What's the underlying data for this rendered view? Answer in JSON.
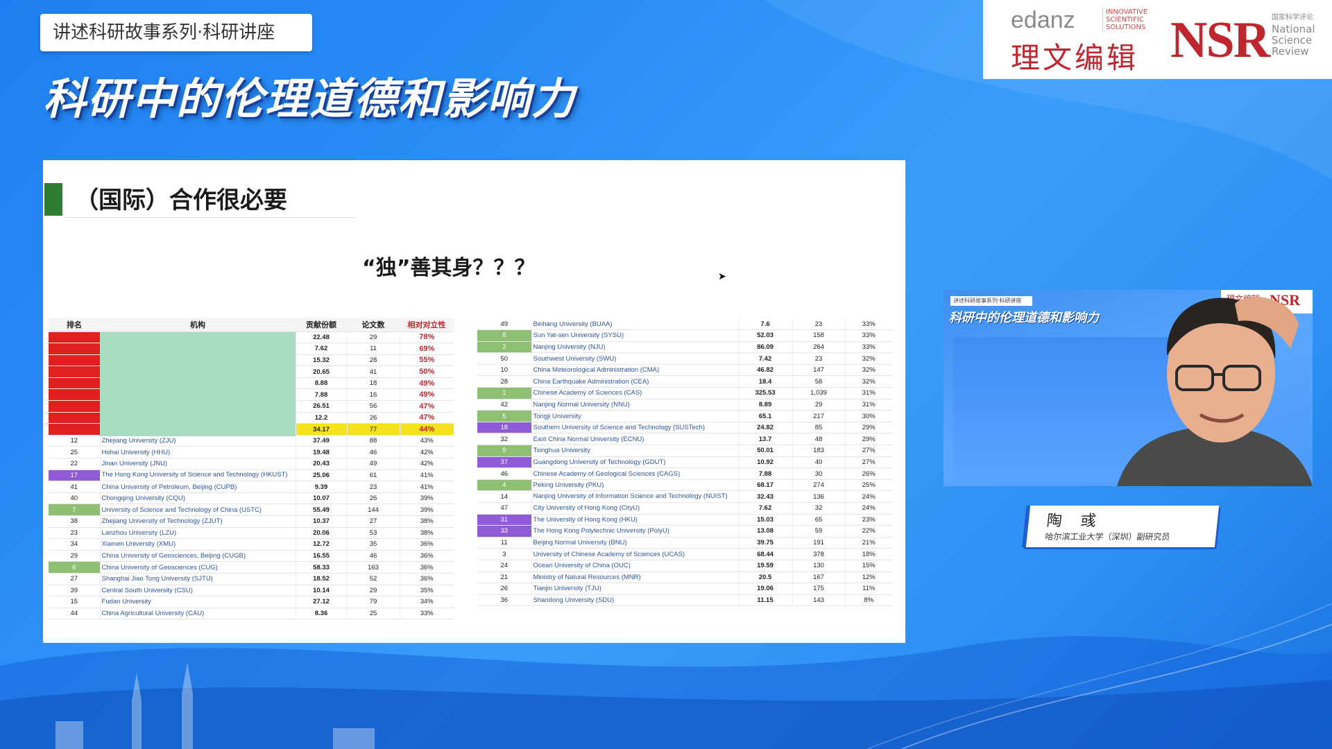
{
  "header": {
    "series_label": "讲述科研故事系列·科研讲座",
    "main_title": "科研中的伦理道德和影响力"
  },
  "logos": {
    "edanz_word": "edanz",
    "edanz_tag": "INNOVATIVE SCIENTIFIC SOLUTIONS",
    "edanz_cn": "理文编辑",
    "nsr_word": "NSR",
    "nsr_cn": "国家科学评论",
    "nsr_side": [
      "National",
      "Science",
      "Review"
    ]
  },
  "colors": {
    "brand_red": "#c0262d",
    "bg_blue": "#2a8ef6",
    "heading_green": "#2e7d32",
    "rank_red": "#e0201f",
    "rank_green": "#8fbf72",
    "rank_purple": "#8f5bd6",
    "highlight_yellow": "#f6e11d"
  },
  "slide": {
    "heading": "（国际）合作很必要",
    "subheading": "“独”善其身？？？",
    "table_left": {
      "headers": [
        "排名",
        "机构",
        "贡献份额",
        "论文数",
        "相对对立性"
      ],
      "rows": [
        {
          "rank": "",
          "name": "",
          "share": "22.48",
          "papers": "29",
          "pct": "78%",
          "rank_style": "red",
          "pct_style": "red"
        },
        {
          "rank": "",
          "name": "",
          "share": "7.62",
          "papers": "11",
          "pct": "69%",
          "rank_style": "red",
          "pct_style": "red"
        },
        {
          "rank": "",
          "name": "",
          "share": "15.32",
          "papers": "28",
          "pct": "55%",
          "rank_style": "red",
          "pct_style": "red"
        },
        {
          "rank": "",
          "name": "",
          "share": "20.65",
          "papers": "41",
          "pct": "50%",
          "rank_style": "red",
          "pct_style": "red"
        },
        {
          "rank": "",
          "name": "",
          "share": "8.88",
          "papers": "18",
          "pct": "49%",
          "rank_style": "red",
          "pct_style": "red"
        },
        {
          "rank": "",
          "name": "",
          "share": "7.88",
          "papers": "16",
          "pct": "49%",
          "rank_style": "red",
          "pct_style": "red"
        },
        {
          "rank": "",
          "name": "",
          "share": "26.51",
          "papers": "56",
          "pct": "47%",
          "rank_style": "red",
          "pct_style": "red"
        },
        {
          "rank": "",
          "name": "",
          "share": "12.2",
          "papers": "26",
          "pct": "47%",
          "rank_style": "red",
          "pct_style": "red"
        },
        {
          "rank": "",
          "name": "",
          "share": "34.17",
          "papers": "77",
          "pct": "44%",
          "rank_style": "red",
          "pct_style": "red",
          "row_style": "yellow"
        },
        {
          "rank": "12",
          "name": "Zhejiang University (ZJU)",
          "share": "37.49",
          "papers": "88",
          "pct": "43%"
        },
        {
          "rank": "25",
          "name": "Hohai University (HHU)",
          "share": "19.48",
          "papers": "46",
          "pct": "42%"
        },
        {
          "rank": "22",
          "name": "Jinan University (JNU)",
          "share": "20.43",
          "papers": "49",
          "pct": "42%"
        },
        {
          "rank": "17",
          "name": "The Hong Kong University of Science and Technology (HKUST)",
          "share": "25.06",
          "papers": "61",
          "pct": "41%",
          "rank_style": "purple",
          "tall": true
        },
        {
          "rank": "41",
          "name": "China University of Petroleum, Beijing (CUPB)",
          "share": "9.39",
          "papers": "23",
          "pct": "41%"
        },
        {
          "rank": "40",
          "name": "Chongqing University (CQU)",
          "share": "10.07",
          "papers": "26",
          "pct": "39%"
        },
        {
          "rank": "7",
          "name": "University of Science and Technology of China (USTC)",
          "share": "55.49",
          "papers": "144",
          "pct": "39%",
          "rank_style": "green"
        },
        {
          "rank": "38",
          "name": "Zhejiang University of Technology (ZJUT)",
          "share": "10.37",
          "papers": "27",
          "pct": "38%"
        },
        {
          "rank": "23",
          "name": "Lanzhou University (LZU)",
          "share": "20.06",
          "papers": "53",
          "pct": "38%"
        },
        {
          "rank": "34",
          "name": "Xiamen University (XMU)",
          "share": "12.72",
          "papers": "35",
          "pct": "36%"
        },
        {
          "rank": "29",
          "name": "China University of Geosciences, Beijing (CUGB)",
          "share": "16.55",
          "papers": "46",
          "pct": "36%"
        },
        {
          "rank": "6",
          "name": "China University of Geosciences (CUG)",
          "share": "58.33",
          "papers": "163",
          "pct": "36%",
          "rank_style": "green"
        },
        {
          "rank": "27",
          "name": "Shanghai Jiao Tong University (SJTU)",
          "share": "18.52",
          "papers": "52",
          "pct": "36%"
        },
        {
          "rank": "39",
          "name": "Central South University (CSU)",
          "share": "10.14",
          "papers": "29",
          "pct": "35%"
        },
        {
          "rank": "15",
          "name": "Fudan University",
          "share": "27.12",
          "papers": "79",
          "pct": "34%"
        },
        {
          "rank": "44",
          "name": "China Agricultural University (CAU)",
          "share": "8.36",
          "papers": "25",
          "pct": "33%"
        }
      ]
    },
    "table_right": {
      "rows": [
        {
          "rank": "49",
          "name": "Beihang University (BUAA)",
          "share": "7.6",
          "papers": "23",
          "pct": "33%"
        },
        {
          "rank": "8",
          "name": "Sun Yat-sen University (SYSU)",
          "share": "52.03",
          "papers": "158",
          "pct": "33%",
          "rank_style": "green"
        },
        {
          "rank": "2",
          "name": "Nanjing University (NJU)",
          "share": "86.09",
          "papers": "264",
          "pct": "33%",
          "rank_style": "green"
        },
        {
          "rank": "50",
          "name": "Southwest University (SWU)",
          "share": "7.42",
          "papers": "23",
          "pct": "32%"
        },
        {
          "rank": "10",
          "name": "China Meteorological Administration (CMA)",
          "share": "46.82",
          "papers": "147",
          "pct": "32%"
        },
        {
          "rank": "28",
          "name": "China Earthquake Administration (CEA)",
          "share": "18.4",
          "papers": "58",
          "pct": "32%"
        },
        {
          "rank": "1",
          "name": "Chinese Academy of Sciences (CAS)",
          "share": "325.53",
          "papers": "1,039",
          "pct": "31%",
          "rank_style": "green"
        },
        {
          "rank": "42",
          "name": "Nanjing Normal University (NNU)",
          "share": "8.89",
          "papers": "29",
          "pct": "31%"
        },
        {
          "rank": "5",
          "name": "Tongji University",
          "share": "65.1",
          "papers": "217",
          "pct": "30%",
          "rank_style": "green"
        },
        {
          "rank": "18",
          "name": "Southern University of Science and Technology (SUSTech)",
          "share": "24.82",
          "papers": "85",
          "pct": "29%",
          "rank_style": "purple"
        },
        {
          "rank": "32",
          "name": "East China Normal University (ECNU)",
          "share": "13.7",
          "papers": "48",
          "pct": "29%"
        },
        {
          "rank": "9",
          "name": "Tsinghua University",
          "share": "50.01",
          "papers": "183",
          "pct": "27%",
          "rank_style": "green"
        },
        {
          "rank": "37",
          "name": "Guangdong University of Technology (GDUT)",
          "share": "10.92",
          "papers": "40",
          "pct": "27%",
          "rank_style": "purple"
        },
        {
          "rank": "46",
          "name": "Chinese Academy of Geological Sciences (CAGS)",
          "share": "7.88",
          "papers": "30",
          "pct": "26%"
        },
        {
          "rank": "4",
          "name": "Peking University (PKU)",
          "share": "68.17",
          "papers": "274",
          "pct": "25%",
          "rank_style": "green"
        },
        {
          "rank": "14",
          "name": "Nanjing University of Information Science and Technology (NUIST)",
          "share": "32.43",
          "papers": "136",
          "pct": "24%",
          "tall": true
        },
        {
          "rank": "47",
          "name": "City University of Hong Kong (CityU)",
          "share": "7.62",
          "papers": "32",
          "pct": "24%"
        },
        {
          "rank": "31",
          "name": "The University of Hong Kong (HKU)",
          "share": "15.03",
          "papers": "65",
          "pct": "23%",
          "rank_style": "purple"
        },
        {
          "rank": "33",
          "name": "The Hong Kong Polytechnic University (PolyU)",
          "share": "13.08",
          "papers": "59",
          "pct": "22%",
          "rank_style": "purple"
        },
        {
          "rank": "11",
          "name": "Beijing Normal University (BNU)",
          "share": "39.75",
          "papers": "191",
          "pct": "21%"
        },
        {
          "rank": "3",
          "name": "University of Chinese Academy of Sciences (UCAS)",
          "share": "68.44",
          "papers": "378",
          "pct": "18%"
        },
        {
          "rank": "24",
          "name": "Ocean University of China (OUC)",
          "share": "19.59",
          "papers": "130",
          "pct": "15%"
        },
        {
          "rank": "21",
          "name": "Ministry of Natural Resources (MNR)",
          "share": "20.5",
          "papers": "167",
          "pct": "12%"
        },
        {
          "rank": "26",
          "name": "Tianjin University (TJU)",
          "share": "19.06",
          "papers": "175",
          "pct": "11%"
        },
        {
          "rank": "36",
          "name": "Shandong University (SDU)",
          "share": "11.15",
          "papers": "143",
          "pct": "8%"
        }
      ]
    }
  },
  "video": {
    "tag": "讲述科研故事系列·科研讲座",
    "title": "科研中的伦理道德和影响力",
    "logo_cn": "理文编辑",
    "logo_nsr": "NSR"
  },
  "speaker": {
    "name": "陶 彧",
    "title": "哈尔滨工业大学（深圳）副研究员"
  }
}
